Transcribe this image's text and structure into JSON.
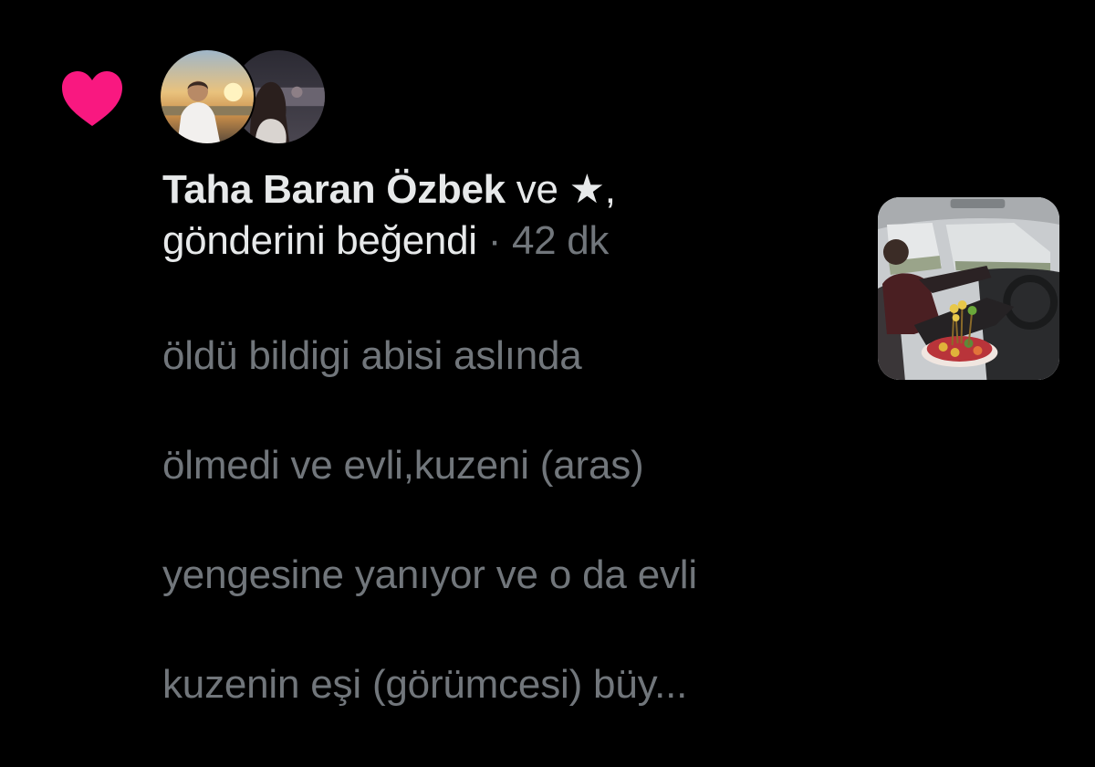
{
  "notification": {
    "type_icon": "heart-icon",
    "accent_color": "#f91880",
    "avatars": [
      {
        "name": "avatar-taha-baran-ozbek"
      },
      {
        "name": "avatar-second-user"
      }
    ],
    "actor_name": "Taha Baran Özbek",
    "connector": " ve ★,",
    "action": "gönderini beğendi",
    "separator": " · ",
    "time": "42 dk",
    "preview_lines": [
      "öldü bildigi abisi aslında",
      "ölmedi ve evli,kuzeni (aras)",
      "yengesine yanıyor ve o da evli",
      "kuzenin eşi (görümcesi) büy..."
    ]
  },
  "colors": {
    "background": "#000000",
    "primary_text": "#e7e9ea",
    "secondary_text": "#71767b"
  }
}
